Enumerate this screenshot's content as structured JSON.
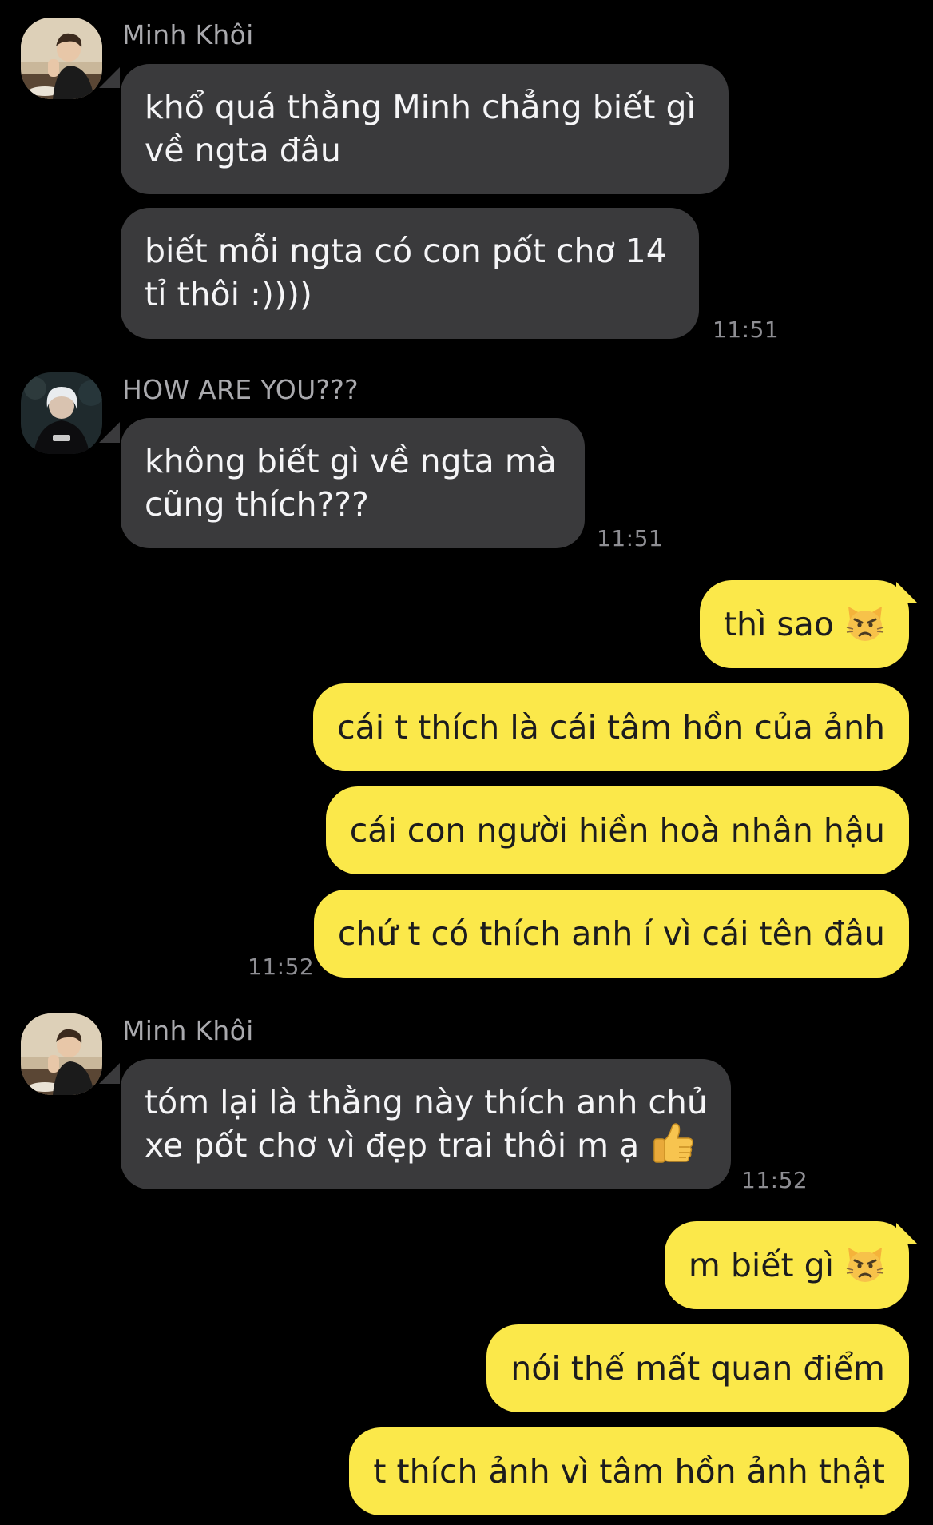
{
  "messages": [
    {
      "sender": "Minh Khôi",
      "bubbles": [
        [
          "khổ quá thằng Minh chẳng biết gì",
          "về ngta đâu"
        ],
        [
          "biết mỗi ngta có con pốt chơ 14",
          "tỉ thôi :))))"
        ]
      ],
      "time": "11:51"
    },
    {
      "sender": "HOW ARE YOU???",
      "bubbles": [
        [
          "không biết gì về ngta mà",
          "cũng thích???"
        ]
      ],
      "time": "11:51"
    },
    {
      "outgoing": [
        {
          "text": "thì sao",
          "emoji": "pouting-cat-emoji"
        },
        {
          "text": "cái t thích là cái tâm hồn của ảnh"
        },
        {
          "text": "cái con người hiền hoà nhân hậu"
        },
        {
          "text": "chứ t có thích anh í vì cái tên đâu"
        }
      ],
      "time": "11:52"
    },
    {
      "sender": "Minh Khôi",
      "bubbles": [
        [
          "tóm lại là thằng này thích anh chủ",
          "xe pốt chơ vì đẹp trai thôi m ạ"
        ]
      ],
      "emoji": "thumbs-up-emoji",
      "time": "11:52"
    },
    {
      "outgoing": [
        {
          "text": "m biết gì",
          "emoji": "pouting-cat-emoji"
        },
        {
          "text": "nói thế mất quan điểm"
        },
        {
          "text": "t thích ảnh vì tâm hồn ảnh thật"
        }
      ]
    }
  ],
  "colors": {
    "background": "#000000",
    "incoming_bubble": "#3a3a3c",
    "outgoing_bubble": "#fbe84a",
    "timestamp": "#8e8e93",
    "sender_name": "#a9a9ad"
  }
}
